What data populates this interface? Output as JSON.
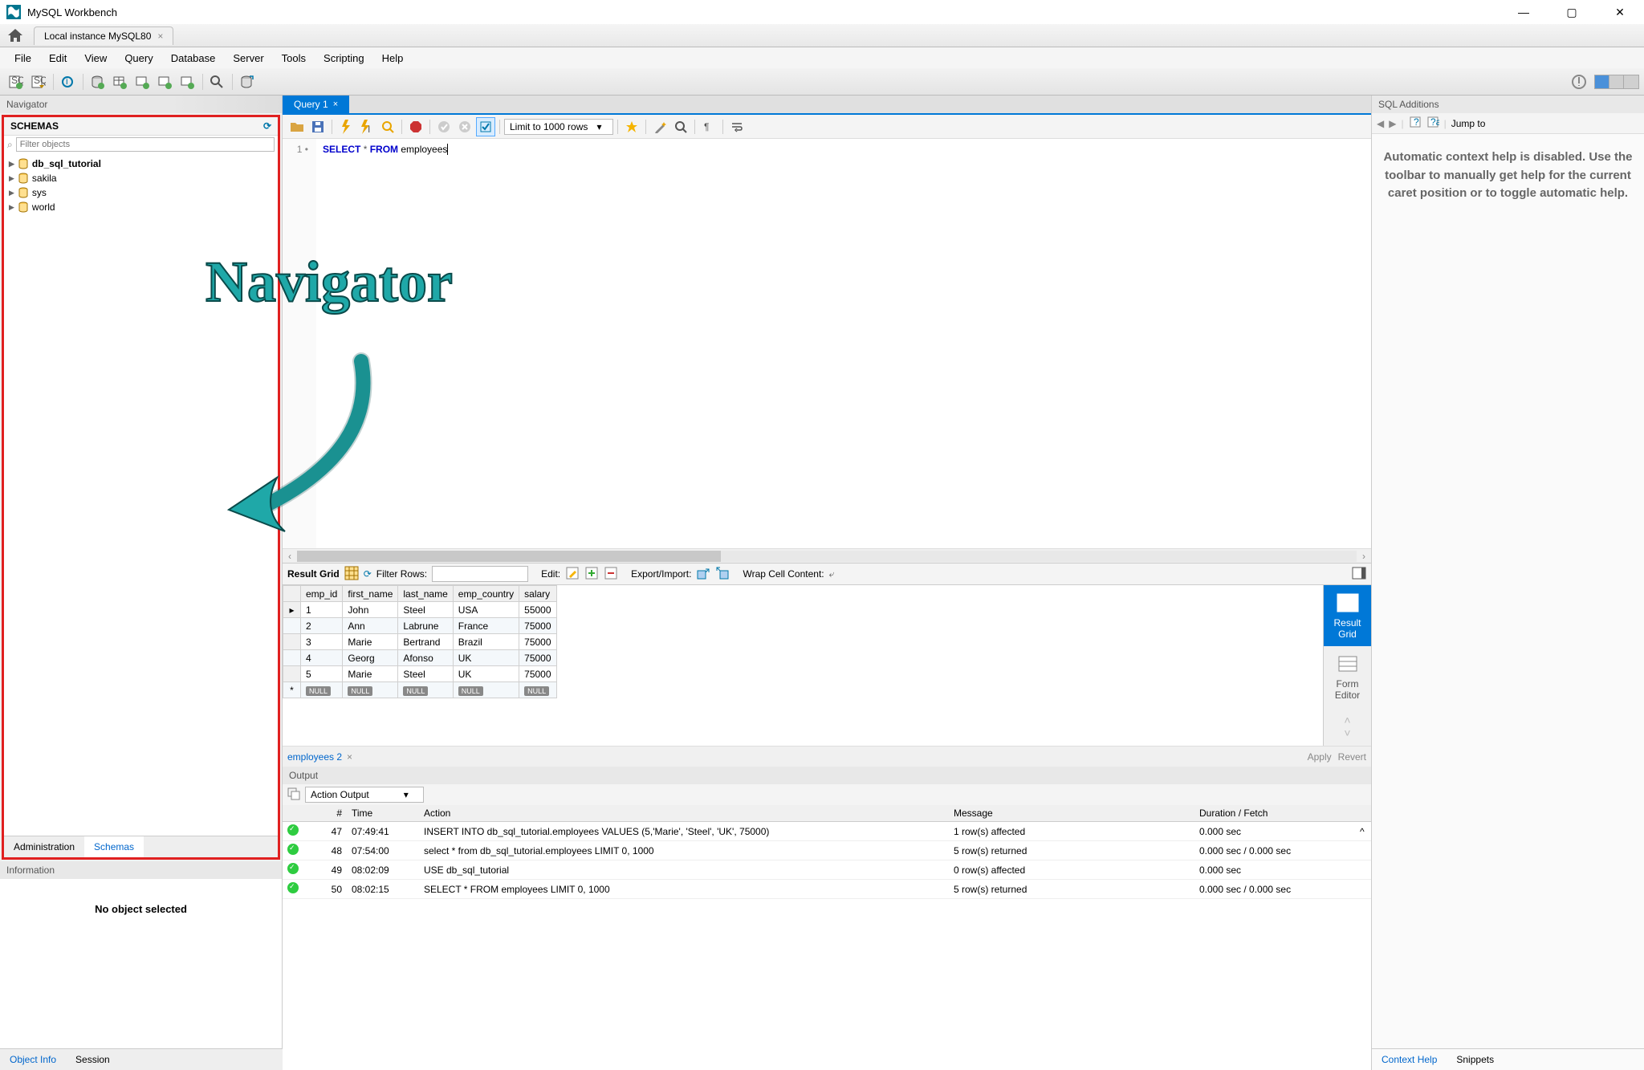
{
  "app": {
    "title": "MySQL Workbench"
  },
  "window_controls": {
    "minimize": "—",
    "maximize": "▢",
    "close": "✕"
  },
  "connection_tab": {
    "label": "Local instance MySQL80"
  },
  "menu": [
    "File",
    "Edit",
    "View",
    "Query",
    "Database",
    "Server",
    "Tools",
    "Scripting",
    "Help"
  ],
  "navigator": {
    "title": "Navigator",
    "schemas_label": "SCHEMAS",
    "filter_placeholder": "Filter objects",
    "schemas": [
      {
        "name": "db_sql_tutorial",
        "bold": true
      },
      {
        "name": "sakila",
        "bold": false
      },
      {
        "name": "sys",
        "bold": false
      },
      {
        "name": "world",
        "bold": false
      }
    ],
    "tabs": {
      "admin": "Administration",
      "schemas": "Schemas"
    }
  },
  "information": {
    "title": "Information",
    "body": "No object selected",
    "tabs": {
      "object": "Object Info",
      "session": "Session"
    }
  },
  "query_tab": {
    "label": "Query 1"
  },
  "editor_toolbar": {
    "limit_label": "Limit to 1000 rows"
  },
  "sql": {
    "line_no": "1",
    "select": "SELECT",
    "star": "*",
    "from": "FROM",
    "ident": "employees"
  },
  "result_toolbar": {
    "title": "Result Grid",
    "filter": "Filter Rows:",
    "edit": "Edit:",
    "export": "Export/Import:",
    "wrap": "Wrap Cell Content:"
  },
  "grid": {
    "columns": [
      "emp_id",
      "first_name",
      "last_name",
      "emp_country",
      "salary"
    ],
    "rows": [
      [
        "1",
        "John",
        "Steel",
        "USA",
        "55000"
      ],
      [
        "2",
        "Ann",
        "Labrune",
        "France",
        "75000"
      ],
      [
        "3",
        "Marie",
        "Bertrand",
        "Brazil",
        "75000"
      ],
      [
        "4",
        "Georg",
        "Afonso",
        "UK",
        "75000"
      ],
      [
        "5",
        "Marie",
        "Steel",
        "UK",
        "75000"
      ]
    ],
    "null_label": "NULL"
  },
  "side_tools": {
    "grid": "Result\nGrid",
    "form": "Form\nEditor"
  },
  "result_tab": {
    "label": "employees 2",
    "apply": "Apply",
    "revert": "Revert"
  },
  "output": {
    "title": "Output",
    "selector": "Action Output",
    "columns": {
      "num": "#",
      "time": "Time",
      "action": "Action",
      "message": "Message",
      "duration": "Duration / Fetch"
    },
    "rows": [
      {
        "num": "47",
        "time": "07:49:41",
        "action": "INSERT INTO db_sql_tutorial.employees VALUES (5,'Marie', 'Steel', 'UK', 75000)",
        "message": "1 row(s) affected",
        "duration": "0.000 sec"
      },
      {
        "num": "48",
        "time": "07:54:00",
        "action": "select * from db_sql_tutorial.employees LIMIT 0, 1000",
        "message": "5 row(s) returned",
        "duration": "0.000 sec / 0.000 sec"
      },
      {
        "num": "49",
        "time": "08:02:09",
        "action": "USE db_sql_tutorial",
        "message": "0 row(s) affected",
        "duration": "0.000 sec"
      },
      {
        "num": "50",
        "time": "08:02:15",
        "action": "SELECT * FROM employees LIMIT 0, 1000",
        "message": "5 row(s) returned",
        "duration": "0.000 sec / 0.000 sec"
      }
    ]
  },
  "additions": {
    "title": "SQL Additions",
    "jump": "Jump to",
    "body": "Automatic context help is disabled. Use the toolbar to manually get help for the current caret position or to toggle automatic help.",
    "tabs": {
      "context": "Context Help",
      "snippets": "Snippets"
    }
  },
  "annotation": {
    "text": "Navigator"
  }
}
